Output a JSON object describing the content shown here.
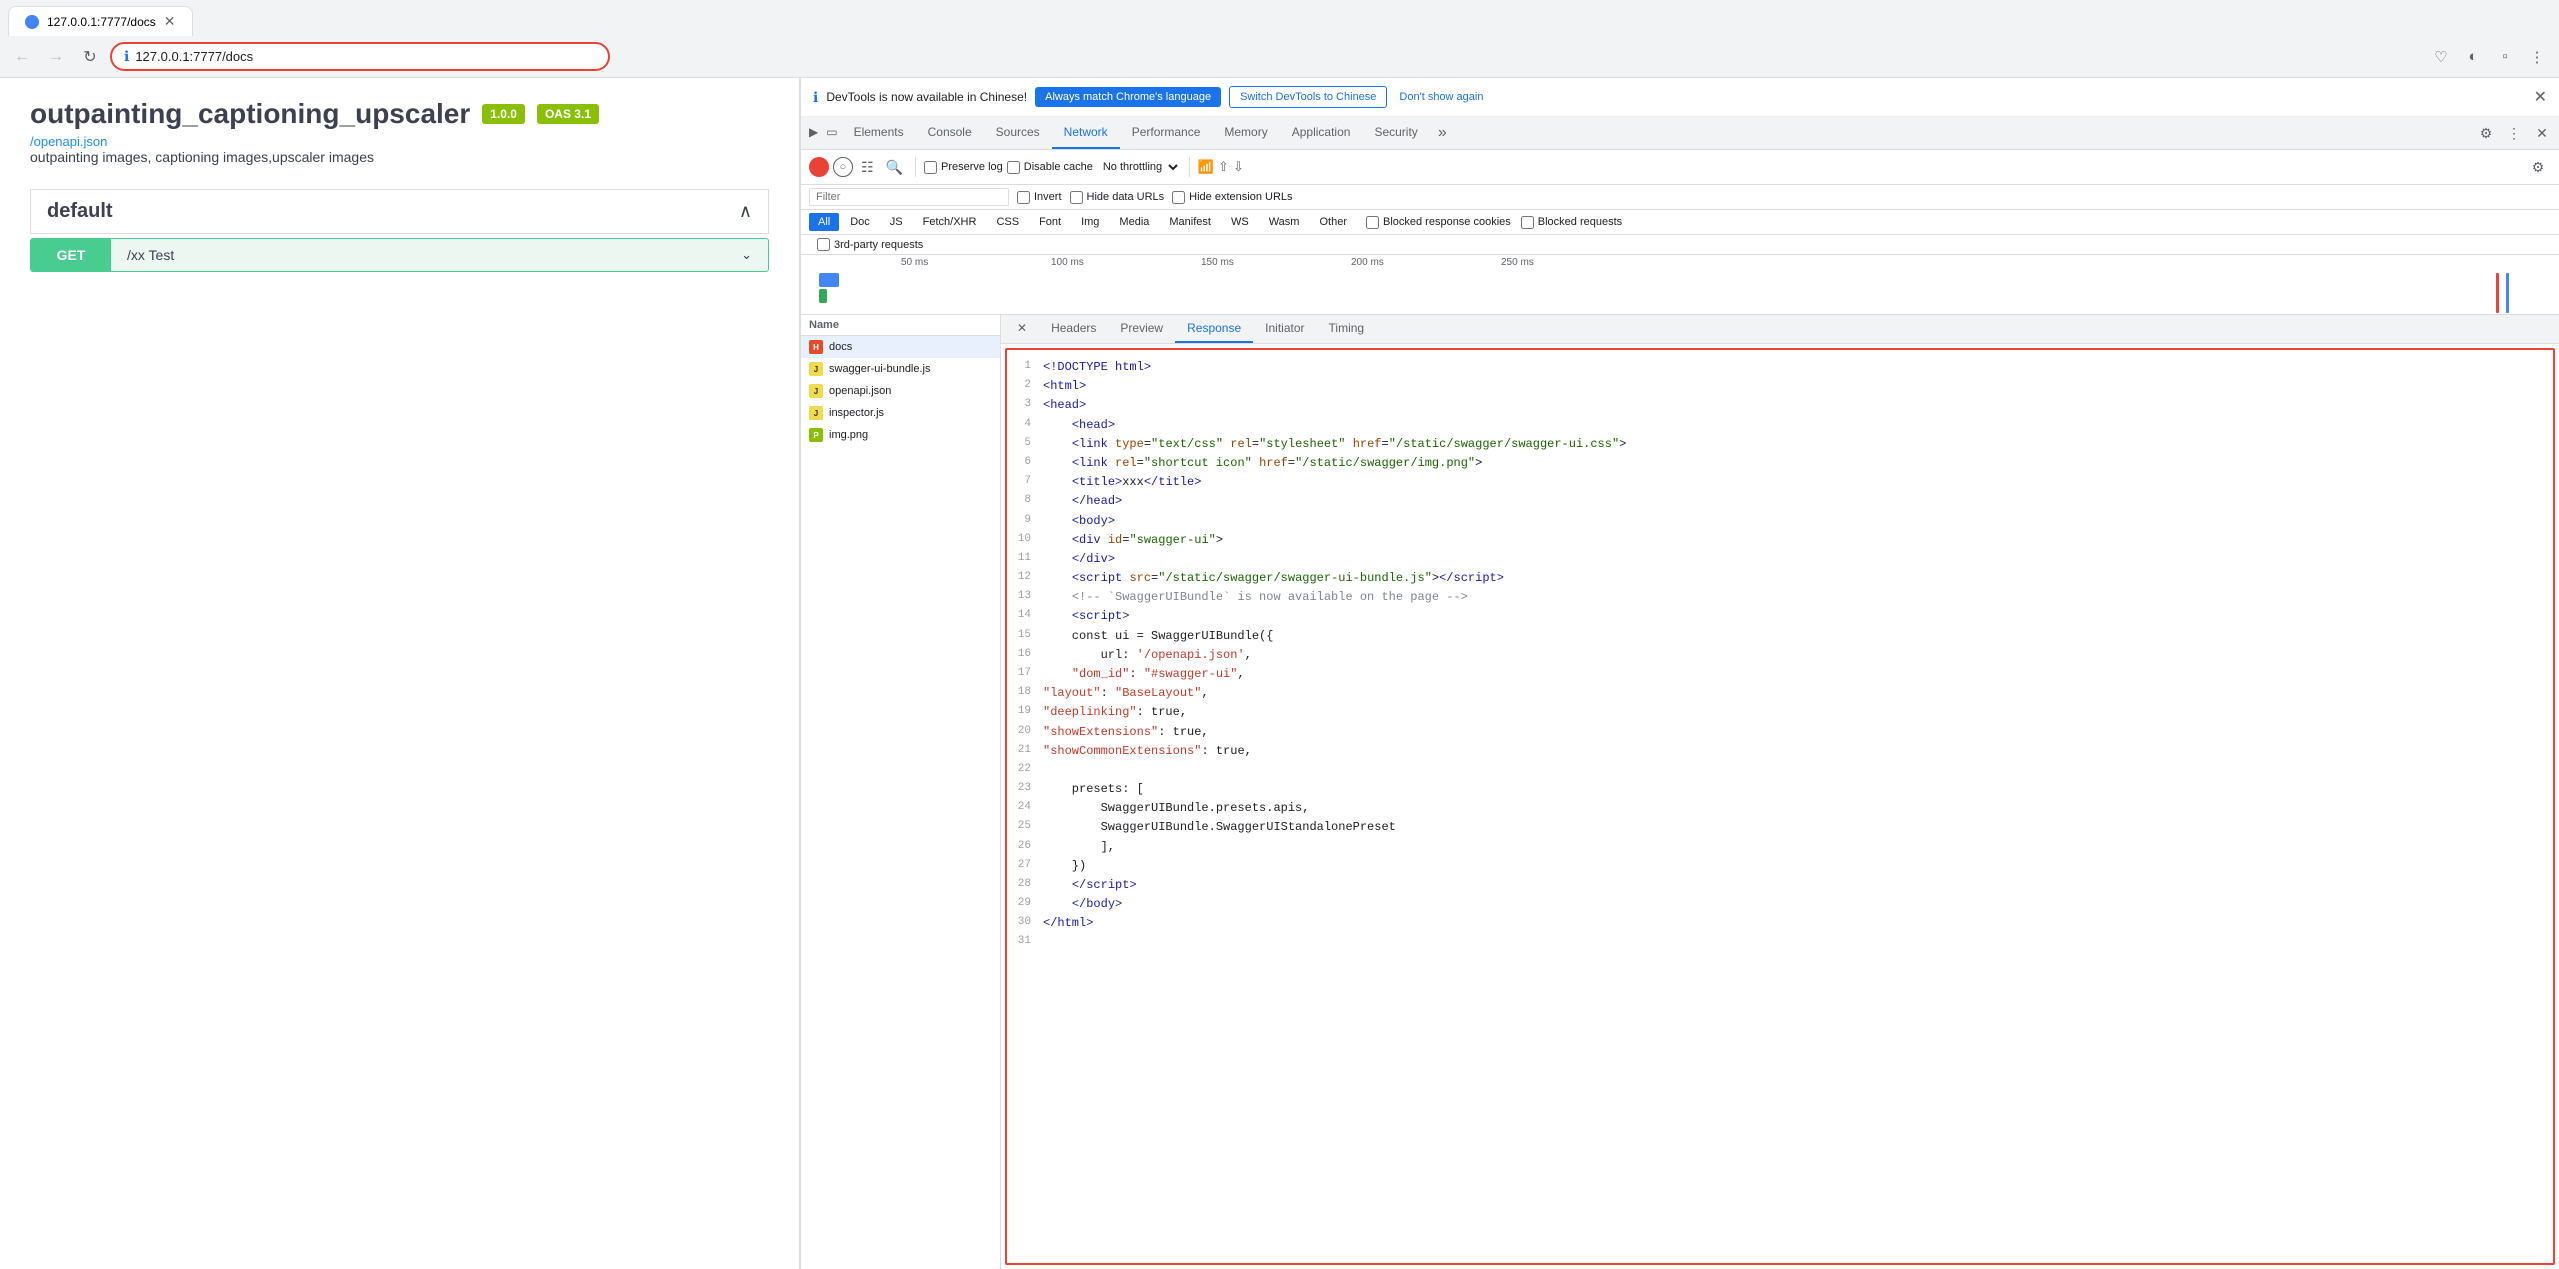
{
  "browser": {
    "tab_title": "127.0.0.1:7777/docs",
    "address": "127.0.0.1:7777/docs",
    "favicon_color": "#4285f4"
  },
  "swagger": {
    "title": "outpainting_captioning_upscaler",
    "badge_version": "1.0.0",
    "badge_oas": "OAS 3.1",
    "link": "/openapi.json",
    "description": "outpainting images, captioning images,upscaler images",
    "section": "default",
    "endpoint_method": "GET",
    "endpoint_path": "/xx  Test"
  },
  "devtools": {
    "notification_text": "DevTools is now available in Chinese!",
    "btn_match_label": "Always match Chrome's language",
    "btn_switch_label": "Switch DevTools to Chinese",
    "dont_show_label": "Don't show again",
    "tabs": [
      "Elements",
      "Console",
      "Sources",
      "Network",
      "Performance",
      "Memory",
      "Application",
      "Security"
    ],
    "active_tab": "Network",
    "toolbar": {
      "preserve_log": "Preserve log",
      "disable_cache": "Disable cache",
      "throttle": "No throttling",
      "invert": "Invert",
      "hide_data_urls": "Hide data URLs",
      "hide_ext_urls": "Hide extension URLs"
    },
    "type_filters": [
      "All",
      "Doc",
      "JS",
      "Fetch/XHR",
      "CSS",
      "Font",
      "Img",
      "Media",
      "Manifest",
      "WS",
      "Wasm",
      "Other"
    ],
    "active_filter": "All",
    "third_party": "3rd-party requests",
    "blocked_cookies": "Blocked response cookies",
    "blocked_requests": "Blocked requests",
    "filter_placeholder": "Filter",
    "timeline": {
      "labels": [
        "50 ms",
        "100 ms",
        "150 ms",
        "200 ms",
        "250 ms"
      ]
    },
    "file_list": {
      "header": "Name",
      "files": [
        {
          "name": "docs",
          "type": "html",
          "selected": true
        },
        {
          "name": "swagger-ui-bundle.js",
          "type": "js"
        },
        {
          "name": "openapi.json",
          "type": "json"
        },
        {
          "name": "inspector.js",
          "type": "js"
        },
        {
          "name": "img.png",
          "type": "png"
        }
      ]
    },
    "detail_tabs": [
      "Headers",
      "Preview",
      "Response",
      "Initiator",
      "Timing"
    ],
    "active_detail_tab": "Response",
    "response_lines": [
      {
        "num": 1,
        "html": "<span class='tag'>&lt;!DOCTYPE html&gt;</span>"
      },
      {
        "num": 2,
        "html": "<span class='tag'>&lt;html&gt;</span>"
      },
      {
        "num": 3,
        "html": "<span class='tag'>&lt;head&gt;</span>"
      },
      {
        "num": 4,
        "html": "    <span class='tag'>&lt;head&gt;</span>"
      },
      {
        "num": 5,
        "html": "    <span class='tag'>&lt;link</span> <span class='attr'>type</span>=<span class='val'>\"text/css\"</span> <span class='attr'>rel</span>=<span class='val'>\"stylesheet\"</span> <span class='attr'>href</span>=<span class='val'>\"/static/swagger/swagger-ui.css\"</span>&gt;"
      },
      {
        "num": 6,
        "html": "    <span class='tag'>&lt;link</span> <span class='attr'>rel</span>=<span class='val'>\"shortcut icon\"</span> <span class='attr'>href</span>=<span class='val'>\"/static/swagger/img.png\"</span>&gt;"
      },
      {
        "num": 7,
        "html": "    <span class='tag'>&lt;title&gt;</span>xxx<span class='tag'>&lt;/title&gt;</span>"
      },
      {
        "num": 8,
        "html": "    <span class='tag'>&lt;/head&gt;</span>"
      },
      {
        "num": 9,
        "html": "    <span class='tag'>&lt;body&gt;</span>"
      },
      {
        "num": 10,
        "html": "    <span class='tag'>&lt;div</span> <span class='attr'>id</span>=<span class='val'>\"swagger-ui\"</span>&gt;"
      },
      {
        "num": 11,
        "html": "    <span class='tag'>&lt;/div&gt;</span>"
      },
      {
        "num": 12,
        "html": "    <span class='tag'>&lt;script</span> <span class='attr'>src</span>=<span class='val'>\"/static/swagger/swagger-ui-bundle.js\"</span>&gt;<span class='tag'>&lt;/script&gt;</span>"
      },
      {
        "num": 13,
        "html": "    <span class='comment'>&lt;!-- `SwaggerUIBundle` is now available on the page --&gt;</span>"
      },
      {
        "num": 14,
        "html": "    <span class='tag'>&lt;script&gt;</span>"
      },
      {
        "num": 15,
        "html": "    const ui = SwaggerUIBundle({"
      },
      {
        "num": 16,
        "html": "        url: <span class='js-str'>'/openapi.json'</span>,"
      },
      {
        "num": 17,
        "html": "    <span class='js-str'>\"dom_id\"</span>: <span class='js-str'>\"#swagger-ui\"</span>,"
      },
      {
        "num": 18,
        "html": "<span class='js-str'>\"layout\"</span>: <span class='js-str'>\"BaseLayout\"</span>,"
      },
      {
        "num": 19,
        "html": "<span class='js-str'>\"deeplinking\"</span>: true,"
      },
      {
        "num": 20,
        "html": "<span class='js-str'>\"showExtensions\"</span>: true,"
      },
      {
        "num": 21,
        "html": "<span class='js-str'>\"showCommonExtensions\"</span>: true,"
      },
      {
        "num": 22,
        "html": ""
      },
      {
        "num": 23,
        "html": "    presets: ["
      },
      {
        "num": 24,
        "html": "        SwaggerUIBundle.presets.apis,"
      },
      {
        "num": 25,
        "html": "        SwaggerUIBundle.SwaggerUIStandalonePreset"
      },
      {
        "num": 26,
        "html": "        ],"
      },
      {
        "num": 27,
        "html": "    })"
      },
      {
        "num": 28,
        "html": "    <span class='tag'>&lt;/script&gt;</span>"
      },
      {
        "num": 29,
        "html": "    <span class='tag'>&lt;/body&gt;</span>"
      },
      {
        "num": 30,
        "html": "<span class='tag'>&lt;/html&gt;</span>"
      },
      {
        "num": 31,
        "html": ""
      }
    ]
  }
}
